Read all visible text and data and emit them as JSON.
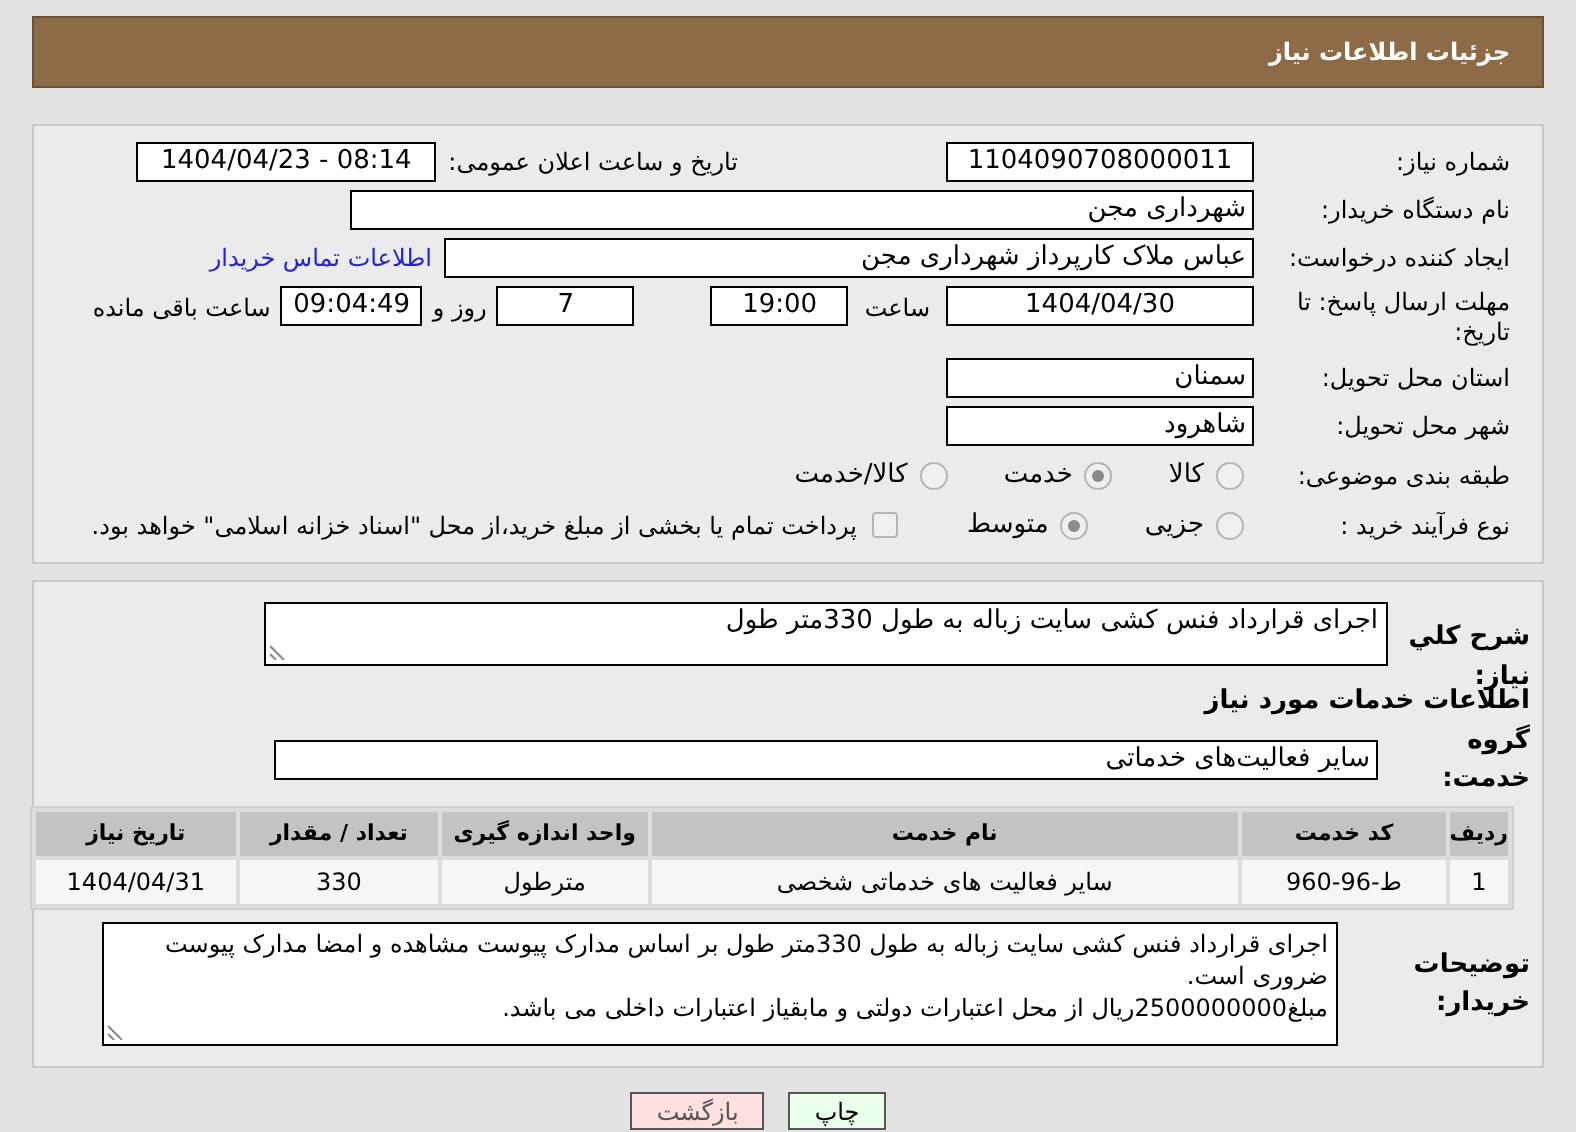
{
  "header": {
    "title": "جزئیات اطلاعات نیاز"
  },
  "need_number": {
    "label": "شماره نیاز:",
    "value": "1104090708000011"
  },
  "announce_date": {
    "label": "تاریخ و ساعت اعلان عمومی:",
    "value": "1404/04/23 - 08:14"
  },
  "buyer_org": {
    "label": "نام دستگاه خریدار:",
    "value": "شهرداری مجن"
  },
  "requester": {
    "label": "ایجاد کننده درخواست:",
    "value": "عباس ملاک کارپرداز شهرداری مجن",
    "link": "اطلاعات تماس خریدار"
  },
  "deadline": {
    "label": "مهلت ارسال پاسخ: تا تاریخ:",
    "date": "1404/04/30",
    "time_label": "ساعت",
    "time": "19:00",
    "days": "7",
    "days_label": "روز و",
    "remaining": "09:04:49",
    "remaining_label": "ساعت باقی مانده"
  },
  "province": {
    "label": "استان محل تحویل:",
    "value": "سمنان"
  },
  "city": {
    "label": "شهر محل تحویل:",
    "value": "شاهرود"
  },
  "category": {
    "label": "طبقه بندی موضوعی:",
    "options": [
      {
        "label": "کالا",
        "selected": false
      },
      {
        "label": "خدمت",
        "selected": true
      },
      {
        "label": "کالا/خدمت",
        "selected": false
      }
    ]
  },
  "process": {
    "label": "نوع فرآیند خرید :",
    "options": [
      {
        "label": "جزیی",
        "selected": false
      },
      {
        "label": "متوسط",
        "selected": true
      }
    ],
    "payment_checkbox": {
      "checked": false,
      "label": "پرداخت تمام یا بخشی از مبلغ خرید،از محل \"اسناد خزانه اسلامی\" خواهد بود."
    }
  },
  "description": {
    "label": "شرح کلي نياز:",
    "value": "اجرای قرارداد فنس کشی سایت زباله به طول 330متر طول"
  },
  "services_heading": "اطلاعات خدمات مورد نیاز",
  "service_group": {
    "label": "گروه خدمت:",
    "value": "سایر فعالیت‌های خدماتی"
  },
  "table": {
    "columns": [
      "ردیف",
      "کد خدمت",
      "نام خدمت",
      "واحد اندازه گیری",
      "تعداد / مقدار",
      "تاریخ نیاز"
    ],
    "rows": [
      [
        "1",
        "ط-96-960",
        "سایر فعالیت های خدماتی شخصی",
        "مترطول",
        "330",
        "1404/04/31"
      ]
    ]
  },
  "buyer_notes": {
    "label": "توضیحات خریدار:",
    "lines": [
      "اجرای قرارداد فنس کشی سایت زباله به طول 330متر طول  بر اساس مدارک پیوست مشاهده و امضا مدارک پیوست ضروری است.",
      "مبلغ2500000000ریال از محل اعتبارات دولتی و مابقیاز اعتبارات داخلی می باشد."
    ]
  },
  "buttons": [
    {
      "kind": "print",
      "label": "چاپ"
    },
    {
      "kind": "back",
      "label": "بازگشت"
    }
  ]
}
